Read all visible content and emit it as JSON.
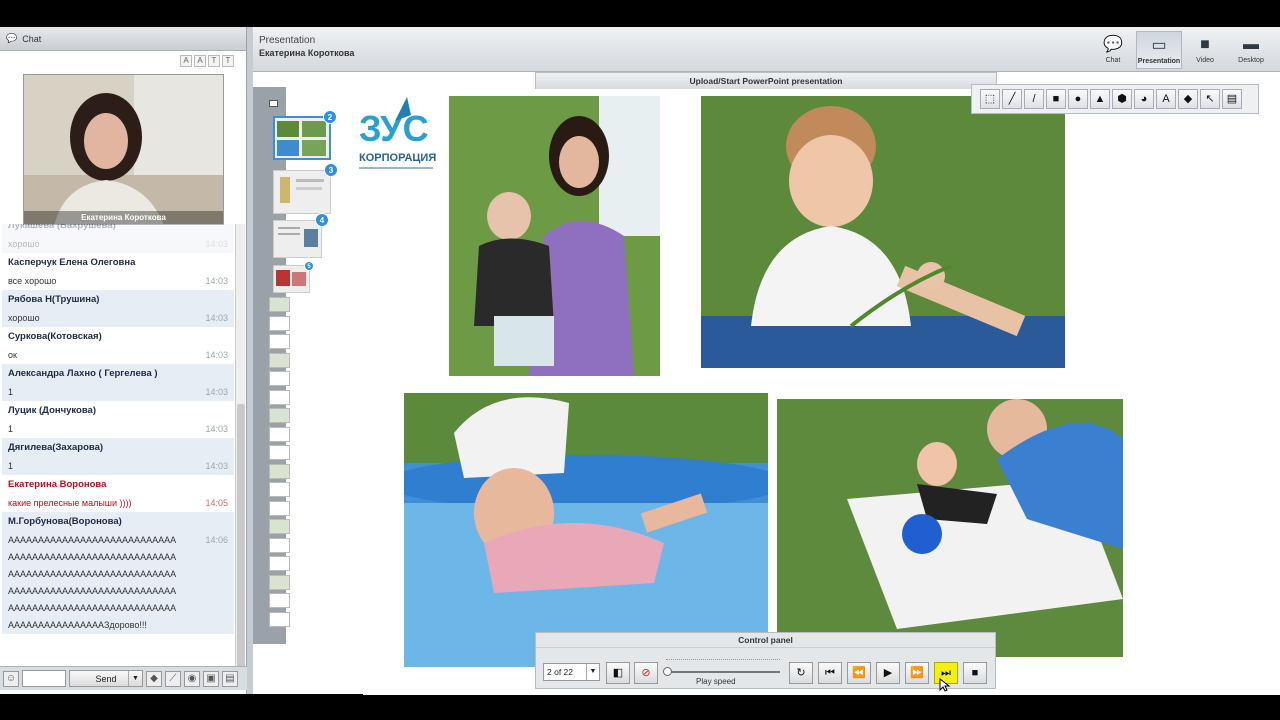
{
  "chat": {
    "title": "Chat",
    "font_tools": [
      "A",
      "A",
      "T",
      "T"
    ],
    "video_name": "Екатерина Короткова",
    "messages": [
      {
        "name": "Лукашева (Вахрушева)",
        "lines": [
          {
            "text": "хорошо",
            "time": "14:03"
          }
        ],
        "faded": true
      },
      {
        "name": "Касперчук Елена Олеговна",
        "lines": [
          {
            "text": "все хорошо",
            "time": "14:03"
          }
        ]
      },
      {
        "name": "Рябова Н(Трушина)",
        "lines": [
          {
            "text": "хорошо",
            "time": "14:03"
          }
        ]
      },
      {
        "name": "Суркова(Котовская)",
        "lines": [
          {
            "text": "ок",
            "time": "14:03"
          }
        ]
      },
      {
        "name": "Александра Лахно ( Гергелева )",
        "lines": [
          {
            "text": "1",
            "time": "14:03"
          }
        ]
      },
      {
        "name": "Луцик (Дончукова)",
        "lines": [
          {
            "text": "1",
            "time": "14:03"
          }
        ]
      },
      {
        "name": "Дягилева(Захарова)",
        "lines": [
          {
            "text": "1",
            "time": "14:03"
          }
        ]
      },
      {
        "name": "Екатерина Воронова",
        "lines": [
          {
            "text": "какие прелесные малыши ))))",
            "time": "14:05"
          }
        ],
        "red": true
      },
      {
        "name": "М.Горбунова(Воронова)",
        "lines": [
          {
            "text": "АААААААААААААААААААААААААААА",
            "time": "14:06"
          },
          {
            "text": "АААААААААААААААААААААААААААА",
            "time": ""
          },
          {
            "text": "АААААААААААААААААААААААААААА",
            "time": ""
          },
          {
            "text": "АААААААААААААААААААААААААААА",
            "time": ""
          },
          {
            "text": "АААААААААААААААААААААААААААА",
            "time": ""
          },
          {
            "text": "ААААААААААААААААЗдорово!!!",
            "time": ""
          }
        ]
      }
    ],
    "input_value": "",
    "send_label": "Send"
  },
  "presentation": {
    "title": "Presentation",
    "presenter": "Екатерина Короткова",
    "upload_label": "Upload/Start PowerPoint presentation",
    "modes": [
      {
        "label": "Chat",
        "icon": "chat-icon",
        "glyph": "💬",
        "active": false
      },
      {
        "label": "Presentation",
        "icon": "presentation-icon",
        "glyph": "▭",
        "active": true
      },
      {
        "label": "Video",
        "icon": "video-camera-icon",
        "glyph": "■",
        "active": false
      },
      {
        "label": "Desktop",
        "icon": "desktop-icon",
        "glyph": "▬",
        "active": false
      }
    ],
    "thumb_badges": [
      "2",
      "3",
      "4",
      "5"
    ],
    "logo": {
      "text": "ЗУС",
      "caption": "КОРПОРАЦИЯ"
    },
    "tools": [
      {
        "icon": "select-icon",
        "glyph": "⬚"
      },
      {
        "icon": "pencil-icon",
        "glyph": "╱"
      },
      {
        "icon": "line-icon",
        "glyph": "/"
      },
      {
        "icon": "rectangle-icon",
        "glyph": "■"
      },
      {
        "icon": "circle-icon",
        "glyph": "●"
      },
      {
        "icon": "triangle-icon",
        "glyph": "▲"
      },
      {
        "icon": "hexagon-icon",
        "glyph": "⬢"
      },
      {
        "icon": "pie-icon",
        "glyph": "◕"
      },
      {
        "icon": "text-icon",
        "glyph": "A"
      },
      {
        "icon": "eraser-icon",
        "glyph": "◆"
      },
      {
        "icon": "pointer-icon",
        "glyph": "↖"
      },
      {
        "icon": "clear-icon",
        "glyph": "▤"
      }
    ],
    "control_panel": {
      "title": "Control panel",
      "page": "2 of 22",
      "play_speed_label": "Play speed",
      "play_speed_value": 0,
      "buttons": [
        {
          "icon": "restart-icon",
          "glyph": "↻"
        },
        {
          "icon": "first-slide-icon",
          "glyph": "⏮"
        },
        {
          "icon": "previous-slide-icon",
          "glyph": "⏪"
        },
        {
          "icon": "play-icon",
          "glyph": "▶"
        },
        {
          "icon": "next-slide-icon",
          "glyph": "⏩"
        },
        {
          "icon": "last-slide-icon",
          "glyph": "⏭"
        },
        {
          "icon": "stop-icon",
          "glyph": "■"
        }
      ]
    }
  }
}
